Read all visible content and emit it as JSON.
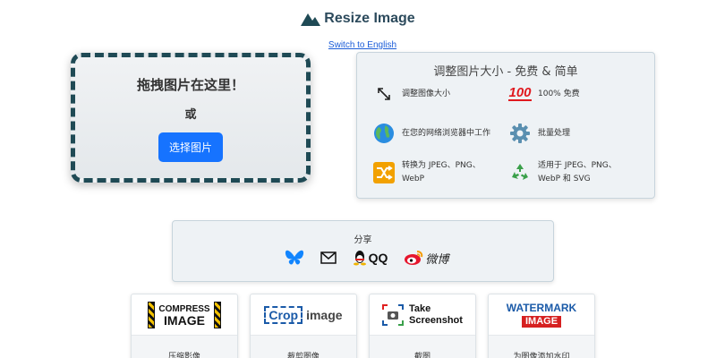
{
  "header": {
    "title": "Resize Image",
    "logo_icon": "mountain-icon",
    "brand_color": "#1f4a55"
  },
  "language_link": "Switch to English",
  "dropzone": {
    "title": "拖拽图片在这里！",
    "or": "或",
    "button": "选择图片",
    "button_color": "#1673ff"
  },
  "features": {
    "title": "调整图片大小 - 免费 & 简单",
    "items": [
      {
        "icon": "resize-arrow-icon",
        "text": "调整图像大小"
      },
      {
        "icon": "hundred-points-icon",
        "glyph": "100",
        "text": "100% 免费"
      },
      {
        "icon": "globe-icon",
        "text": "在您的网络浏览器中工作"
      },
      {
        "icon": "gear-icon",
        "text": "批量处理"
      },
      {
        "icon": "shuffle-icon",
        "text": "转换为 JPEG、PNG、WebP"
      },
      {
        "icon": "recycle-icon",
        "text": "适用于 JPEG、PNG、WebP 和 SVG"
      }
    ]
  },
  "share": {
    "title": "分享",
    "items": [
      {
        "icon": "bluesky-icon"
      },
      {
        "icon": "email-icon"
      },
      {
        "icon": "qq-icon",
        "label": "QQ"
      },
      {
        "icon": "weibo-icon",
        "label": "微博"
      }
    ]
  },
  "tools": [
    {
      "logo": {
        "line1": "COMPRESS",
        "line2": "IMAGE"
      },
      "label": "压缩影像"
    },
    {
      "logo": {
        "word1": "Crop",
        "word2": "image"
      },
      "label": "裁剪图像"
    },
    {
      "logo": {
        "line1": "Take",
        "line2": "Screenshot"
      },
      "label": "截图"
    },
    {
      "logo": {
        "line1": "WATERMARK",
        "line2": "IMAGE"
      },
      "label": "为图像添加水印"
    }
  ]
}
